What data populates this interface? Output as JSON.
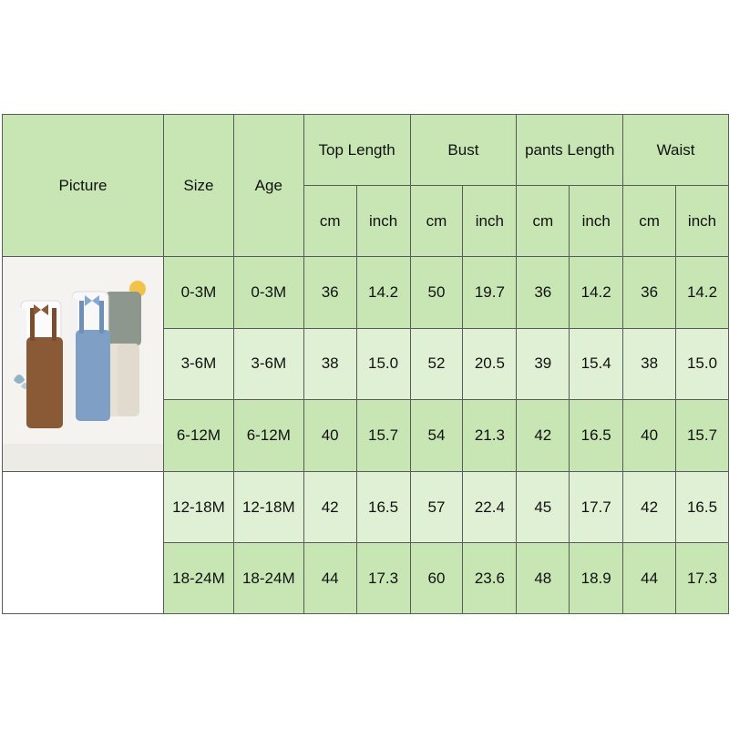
{
  "header": {
    "picture": "Picture",
    "size": "Size",
    "age": "Age",
    "groups": [
      "Top Length",
      "Bust",
      "pants Length",
      "Waist"
    ],
    "units": [
      "cm",
      "inch",
      "cm",
      "inch",
      "cm",
      "inch",
      "cm",
      "inch"
    ]
  },
  "rows": [
    {
      "size": "0-3M",
      "age": "0-3M",
      "values": [
        "36",
        "14.2",
        "50",
        "19.7",
        "36",
        "14.2",
        "36",
        "14.2"
      ]
    },
    {
      "size": "3-6M",
      "age": "3-6M",
      "values": [
        "38",
        "15.0",
        "52",
        "20.5",
        "39",
        "15.4",
        "38",
        "15.0"
      ]
    },
    {
      "size": "6-12M",
      "age": "6-12M",
      "values": [
        "40",
        "15.7",
        "54",
        "21.3",
        "42",
        "16.5",
        "40",
        "15.7"
      ]
    },
    {
      "size": "12-18M",
      "age": "12-18M",
      "values": [
        "42",
        "16.5",
        "57",
        "22.4",
        "45",
        "17.7",
        "42",
        "16.5"
      ]
    },
    {
      "size": "18-24M",
      "age": "18-24M",
      "values": [
        "44",
        "17.3",
        "60",
        "23.6",
        "48",
        "18.9",
        "44",
        "17.3"
      ]
    }
  ],
  "colors": {
    "header_green": "#c8e6b4",
    "row_green_dark": "#c8e6b4",
    "row_green_light": "#e0f0d4",
    "border": "#5a5a5a"
  },
  "picture": {
    "outfits": [
      "brown-corduroy-overall-set",
      "blue-corduroy-overall-set",
      "beige-corduroy-overall-set"
    ]
  }
}
